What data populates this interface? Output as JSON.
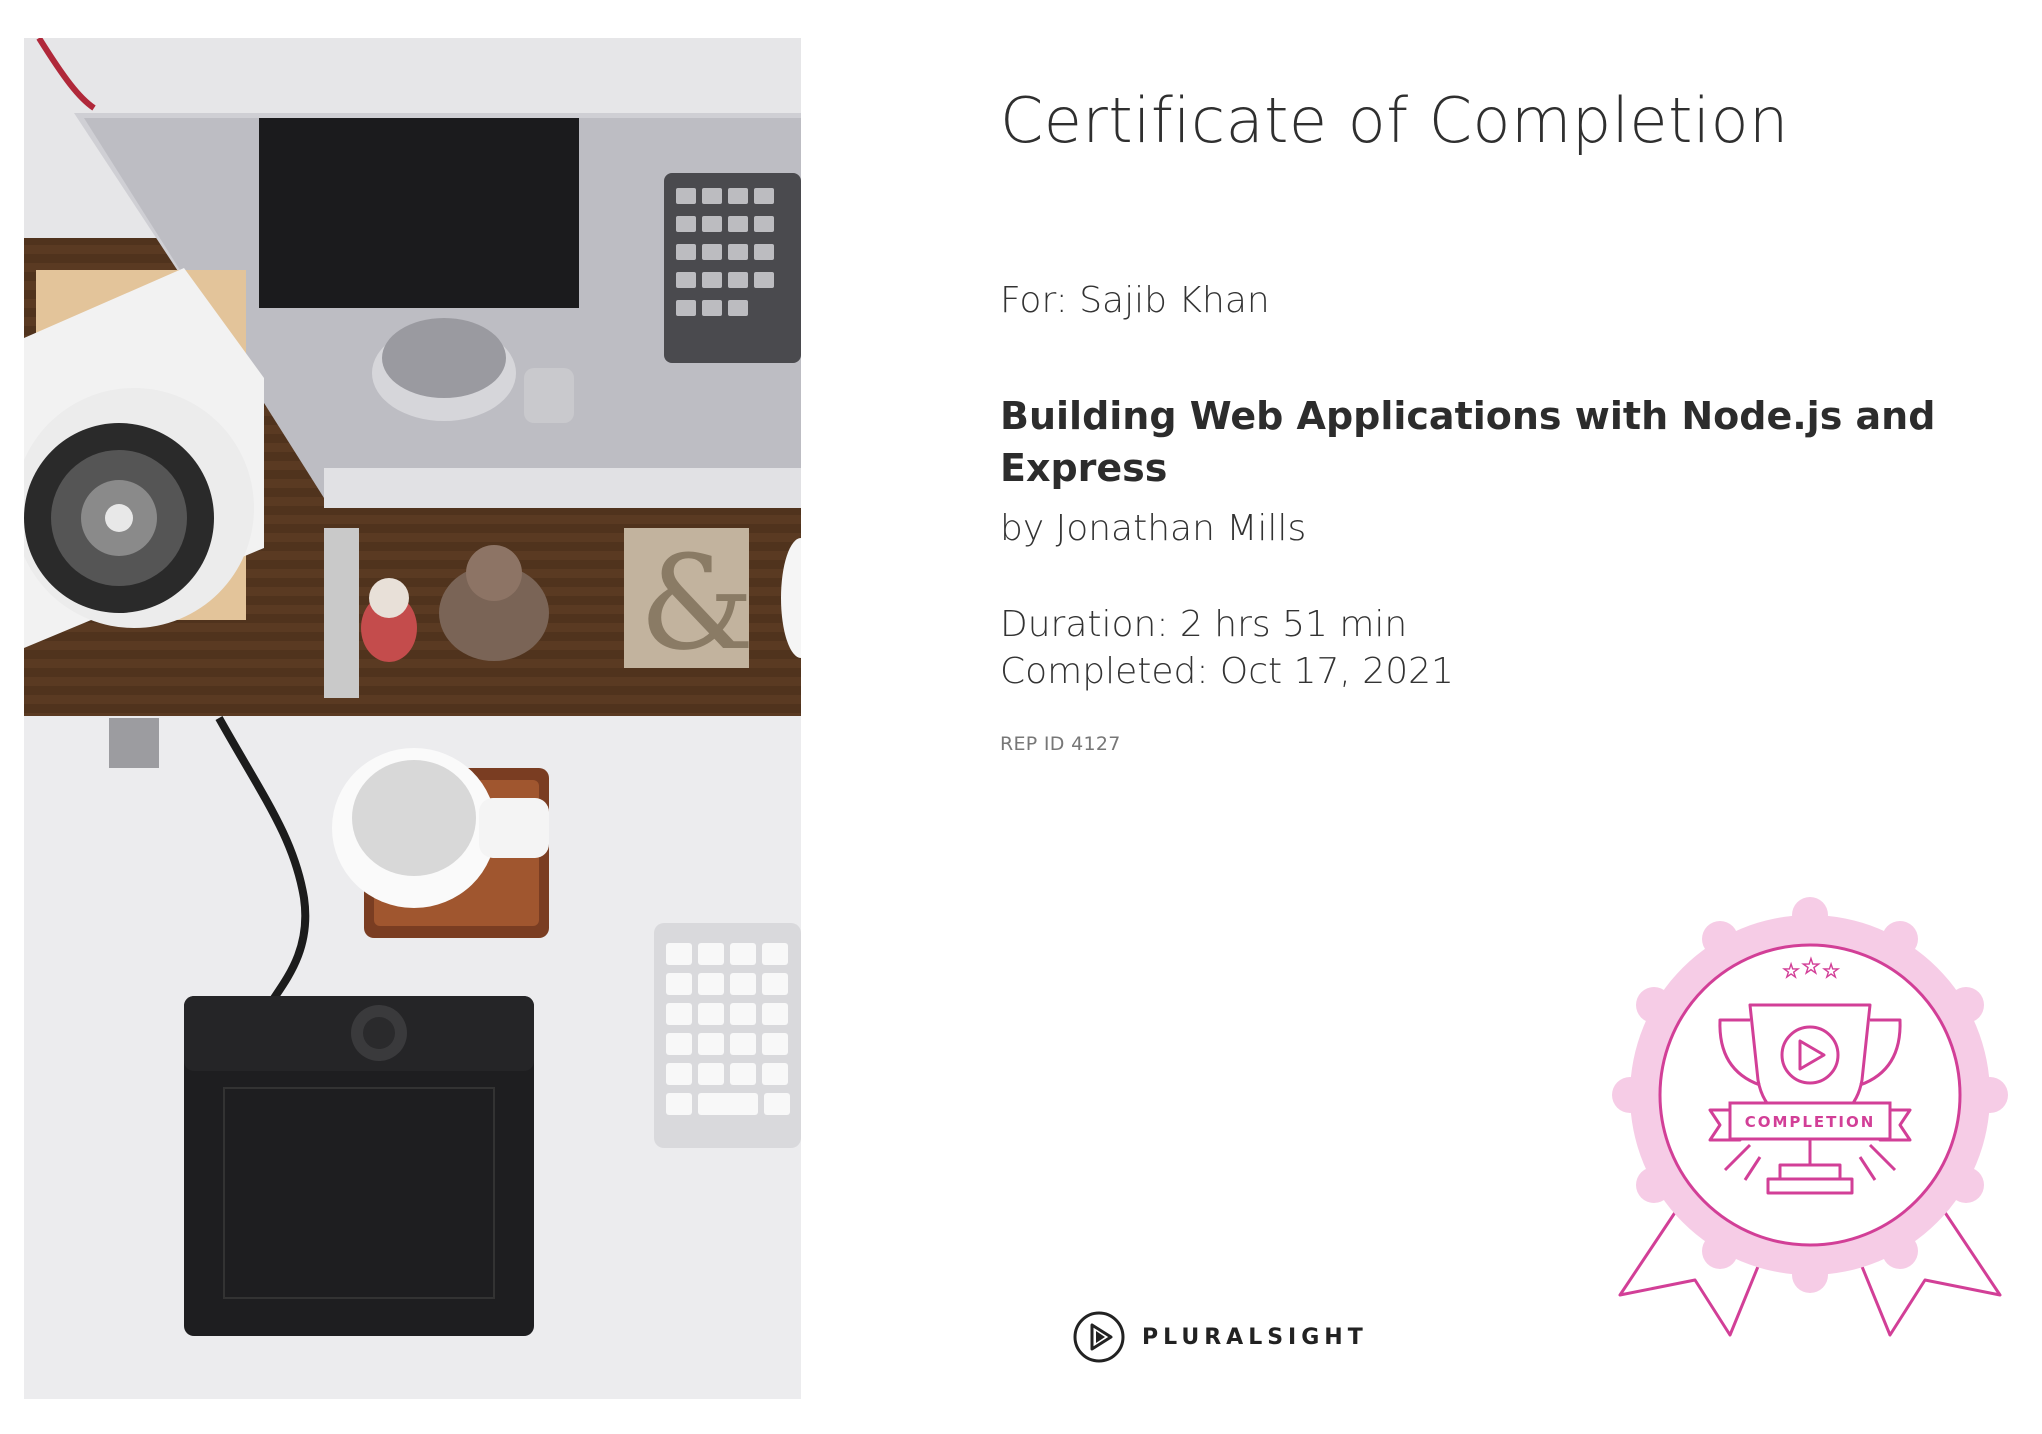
{
  "certificate": {
    "title": "Certificate of Completion",
    "recipient": "For: Sajib Khan",
    "course_title": "Building Web Applications with Node.js and Express",
    "author": "by Jonathan Mills",
    "duration": "Duration: 2 hrs 51 min",
    "completed": "Completed: Oct 17, 2021",
    "rep_id": "REP ID 4127"
  },
  "badge": {
    "label": "COMPLETION",
    "color": "#d23f97",
    "glow_color": "#f4c6e4",
    "icon": "trophy-icon"
  },
  "brand": {
    "name": "PLURALSIGHT",
    "icon": "pluralsight-play-icon"
  },
  "photo": {
    "icon": "desk-workspace-photo"
  }
}
